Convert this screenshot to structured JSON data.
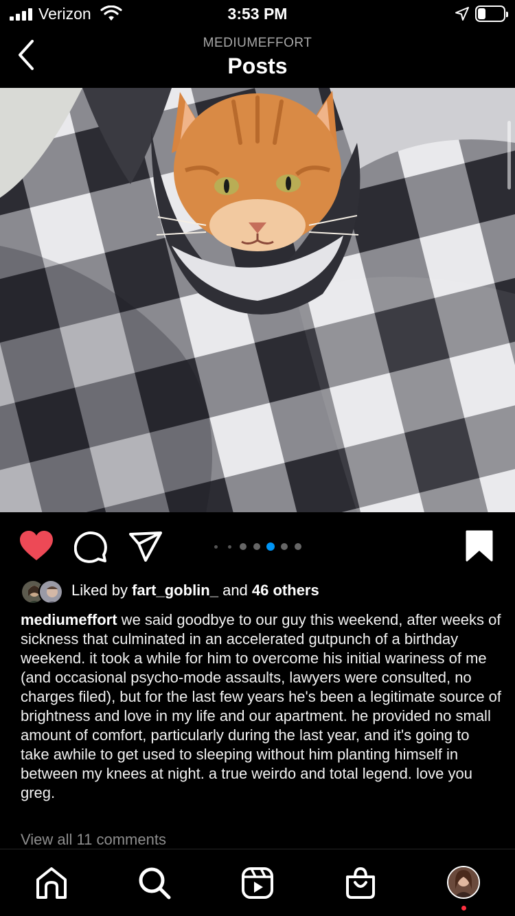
{
  "status_bar": {
    "carrier": "Verizon",
    "time": "3:53 PM",
    "battery_level": 0.3
  },
  "header": {
    "username": "MEDIUMEFFORT",
    "title": "Posts"
  },
  "post": {
    "carousel": {
      "total": 7,
      "active_index": 4
    },
    "liked": true,
    "saved": true,
    "likes": {
      "prefix": "Liked by ",
      "user": "fart_goblin_",
      "connector": " and ",
      "others": "46 others"
    },
    "caption": {
      "username": "mediumeffort",
      "text": " we said goodbye to our guy this weekend, after weeks of sickness that culminated in an accelerated gutpunch of a birthday weekend. it took a while for him to overcome his initial wariness of me (and occasional psycho-mode assaults, lawyers were consulted, no charges filed), but for the last few years he's been a legitimate source of brightness and love in my life and our apartment. he provided no small amount of comfort, particularly during the last year, and it's going to take awhile to get used to sleeping without him planting himself in between my knees at night. a true weirdo and total legend. love you greg."
    },
    "view_comments": "View all 11 comments"
  },
  "tab_bar": {
    "items": [
      "home-icon",
      "search-icon",
      "reels-icon",
      "shop-icon",
      "profile-avatar"
    ]
  },
  "colors": {
    "like_red": "#ed4956",
    "active_dot": "#0095f6",
    "notification": "#ff3040"
  }
}
